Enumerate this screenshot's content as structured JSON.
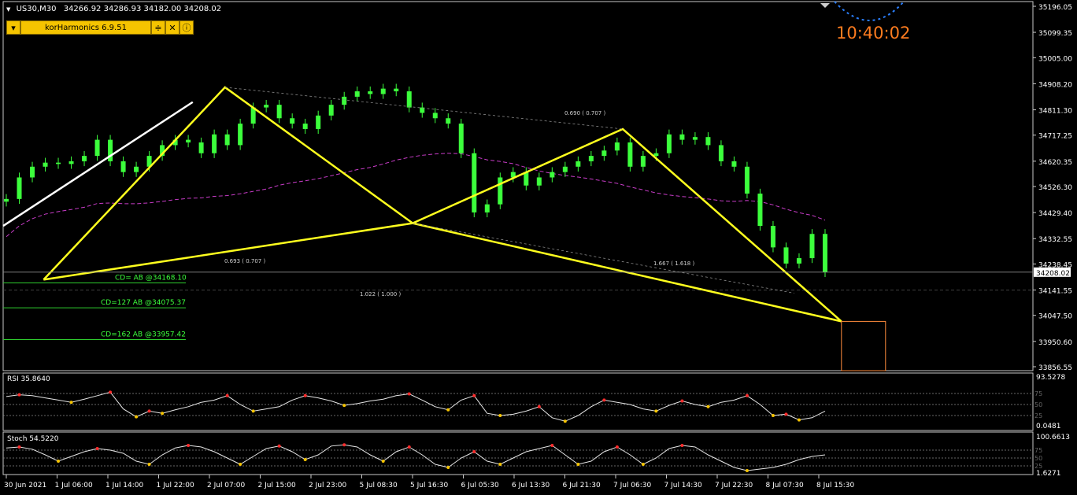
{
  "header": {
    "symbol": "US30,M30",
    "ohlc": "34266.92 34286.93 34182.00 34208.02"
  },
  "indicator_bar": {
    "name": "korHarmonics 6.9.51",
    "settings_icon": "sliders-icon",
    "tools_icon": "tools-icon",
    "info_icon": "info-icon"
  },
  "clock": {
    "time": "10:40:02"
  },
  "colors": {
    "candle": "#3cff3c",
    "pattern": "#ffff1e",
    "trend": "#ffffff",
    "ma": "#c83cc8",
    "target_box": "#ff8c3c",
    "clock": "#ff7c1f"
  },
  "chart_data": [
    {
      "type": "candlestick",
      "price_axis": [
        "35196.05",
        "35099.35",
        "35005.00",
        "34908.20",
        "34811.30",
        "34717.25",
        "34620.35",
        "34526.30",
        "34429.40",
        "34332.55",
        "34238.45",
        "34141.55",
        "34047.50",
        "33950.60",
        "33856.55"
      ],
      "ylim": [
        33856.55,
        35196.05
      ],
      "last_price": "34208.02",
      "time_labels": [
        "30 Jun 2021",
        "1 Jul 06:00",
        "1 Jul 14:00",
        "1 Jul 22:00",
        "2 Jul 07:00",
        "2 Jul 15:00",
        "2 Jul 23:00",
        "5 Jul 08:30",
        "5 Jul 16:30",
        "6 Jul 05:30",
        "6 Jul 13:30",
        "6 Jul 21:30",
        "7 Jul 06:30",
        "7 Jul 14:30",
        "7 Jul 22:30",
        "8 Jul 07:30",
        "8 Jul 15:30"
      ],
      "close_series": [
        34480,
        34560,
        34600,
        34615,
        34610,
        34620,
        34640,
        34700,
        34620,
        34580,
        34600,
        34640,
        34680,
        34700,
        34690,
        34650,
        34720,
        34680,
        34760,
        34820,
        34830,
        34780,
        34760,
        34740,
        34790,
        34830,
        34860,
        34880,
        34870,
        34890,
        34880,
        34820,
        34800,
        34780,
        34760,
        34650,
        34430,
        34460,
        34560,
        34580,
        34530,
        34560,
        34580,
        34600,
        34620,
        34640,
        34660,
        34690,
        34600,
        34640,
        34650,
        34720,
        34700,
        34710,
        34680,
        34620,
        34600,
        34500,
        34380,
        34300,
        34240,
        34260,
        34350,
        34208
      ],
      "patterns": {
        "harmonic_1": [
          [
            30,
            "34180"
          ],
          [
            176,
            "34895"
          ],
          [
            327,
            "34390"
          ]
        ],
        "harmonic_2": [
          [
            327,
            "34390"
          ],
          [
            496,
            "34740"
          ],
          [
            672,
            "34025"
          ]
        ],
        "d_target": "34025"
      },
      "ratios": [
        "0.690 ( 0.707 )",
        "0.693 ( 0.707 )",
        "1.667 ( 1.618 )",
        "1.022 ( 1.000 )"
      ],
      "levels": [
        {
          "label": "CD= AB",
          "price": "@34168.10"
        },
        {
          "label": "CD=127 AB",
          "price": "@34075.37"
        },
        {
          "label": "CD=162 AB",
          "price": "@33957.42"
        }
      ]
    },
    {
      "type": "line",
      "name": "RSI 35.8640",
      "scale_max": "93.5278",
      "scale_min": "0.0481",
      "levels": [
        "75",
        "50",
        "25"
      ],
      "values": [
        68,
        72,
        70,
        65,
        60,
        55,
        62,
        70,
        78,
        40,
        22,
        35,
        30,
        38,
        45,
        55,
        60,
        70,
        50,
        35,
        40,
        45,
        60,
        70,
        65,
        58,
        48,
        52,
        58,
        62,
        70,
        74,
        60,
        45,
        38,
        60,
        70,
        30,
        25,
        28,
        35,
        45,
        20,
        12,
        25,
        45,
        60,
        55,
        50,
        40,
        35,
        48,
        58,
        50,
        45,
        55,
        60,
        70,
        50,
        25,
        28,
        15,
        20,
        35
      ]
    },
    {
      "type": "line",
      "name": "Stoch 54.5220",
      "scale_max": "100.6613",
      "scale_min": "1.6271",
      "levels": [
        "75",
        "50",
        "25"
      ],
      "values": [
        82,
        85,
        78,
        60,
        40,
        55,
        70,
        80,
        75,
        65,
        40,
        30,
        60,
        82,
        90,
        85,
        70,
        50,
        30,
        55,
        80,
        88,
        70,
        45,
        60,
        88,
        92,
        85,
        60,
        40,
        70,
        85,
        60,
        30,
        20,
        50,
        70,
        40,
        30,
        50,
        70,
        80,
        90,
        60,
        30,
        40,
        70,
        85,
        60,
        30,
        50,
        80,
        90,
        85,
        60,
        40,
        20,
        10,
        15,
        20,
        30,
        45,
        55,
        60
      ]
    }
  ]
}
